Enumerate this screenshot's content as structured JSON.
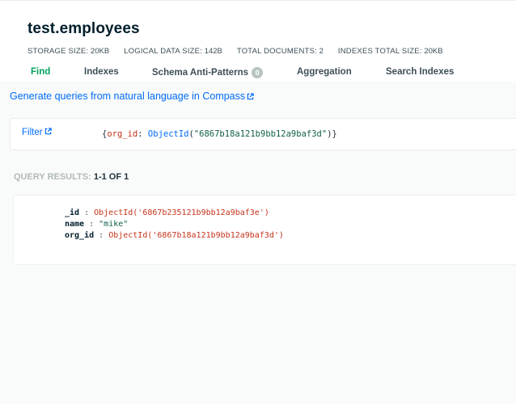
{
  "header": {
    "namespace": "test.employees",
    "stats": [
      {
        "label": "Storage size:",
        "value": "20KB"
      },
      {
        "label": "Logical data size:",
        "value": "142B"
      },
      {
        "label": "Total documents:",
        "value": "2"
      },
      {
        "label": "Indexes total size:",
        "value": "20KB"
      }
    ]
  },
  "tabs": [
    {
      "label": "Find",
      "active": true
    },
    {
      "label": "Indexes"
    },
    {
      "label": "Schema Anti-Patterns",
      "badge": "0"
    },
    {
      "label": "Aggregation"
    },
    {
      "label": "Search Indexes"
    }
  ],
  "nl_link": "Generate queries from natural language in Compass",
  "filter": {
    "label": "Filter",
    "open": "{",
    "key": "org_id",
    "sep": ": ",
    "fn": "ObjectId",
    "paren_open": "(",
    "str": "\"6867b18a121b9bb12a9baf3d\"",
    "close": ")}"
  },
  "results": {
    "label": "Query results:",
    "count": "1-1 OF 1"
  },
  "document": {
    "fields": [
      {
        "key": "_id",
        "sep": " : ",
        "value": "ObjectId('6867b235121b9bb12a9baf3e')",
        "kind": "oid"
      },
      {
        "key": "name",
        "sep": " : ",
        "value": "\"mike\"",
        "kind": "str"
      },
      {
        "key": "org_id",
        "sep": " : ",
        "value": "ObjectId('6867b18a121b9bb12a9baf3d')",
        "kind": "oid"
      }
    ]
  },
  "colors": {
    "active_tab": "#00a35c",
    "link": "#016bf8",
    "oid": "#c7331a",
    "string": "#116149"
  },
  "icons": {
    "external_link": "external-link-icon"
  }
}
